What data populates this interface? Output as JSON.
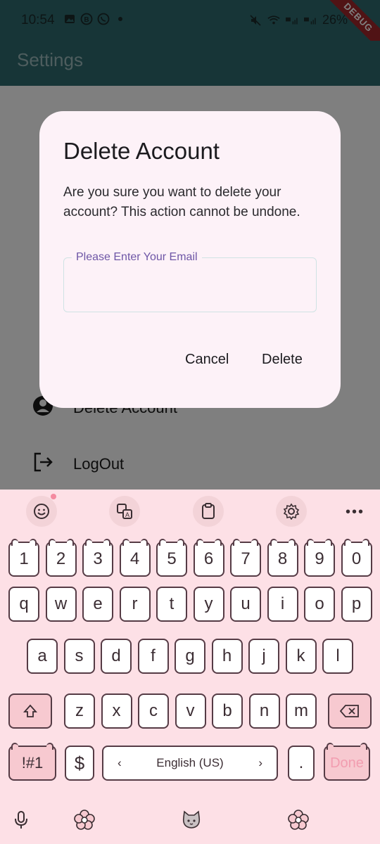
{
  "status_bar": {
    "time": "10:54",
    "battery": "26%",
    "debug_badge": "DEBUG"
  },
  "app_bar": {
    "title": "Settings"
  },
  "settings_list": {
    "items": [
      {
        "label": "Delete Account",
        "icon": "person-circle-icon"
      },
      {
        "label": "LogOut",
        "icon": "logout-icon"
      }
    ]
  },
  "dialog": {
    "title": "Delete Account",
    "message": "Are you sure you want to delete your account? This action cannot be undone.",
    "email_label": "Please Enter Your Email",
    "email_value": "",
    "cancel_label": "Cancel",
    "delete_label": "Delete"
  },
  "keyboard": {
    "toolbar": [
      "emoji-icon",
      "translate-icon",
      "clipboard-icon",
      "settings-gear-icon",
      "more-icon"
    ],
    "row_numbers": [
      "1",
      "2",
      "3",
      "4",
      "5",
      "6",
      "7",
      "8",
      "9",
      "0"
    ],
    "row_top": [
      "q",
      "w",
      "e",
      "r",
      "t",
      "y",
      "u",
      "i",
      "o",
      "p"
    ],
    "row_middle": [
      "a",
      "s",
      "d",
      "f",
      "g",
      "h",
      "j",
      "k",
      "l"
    ],
    "row_bottom": [
      "z",
      "x",
      "c",
      "v",
      "b",
      "n",
      "m"
    ],
    "symbols_label": "!#1",
    "dollar_label": "$",
    "space_label": "English (US)",
    "period_label": ".",
    "done_label": "Done",
    "space_left_arrow": "‹",
    "space_right_arrow": "›"
  },
  "colors": {
    "app_bar": "#2f6b6f",
    "dialog_bg": "#fdf2f8",
    "keyboard_bg": "#fde0e6",
    "accent_label": "#6e56a6"
  }
}
